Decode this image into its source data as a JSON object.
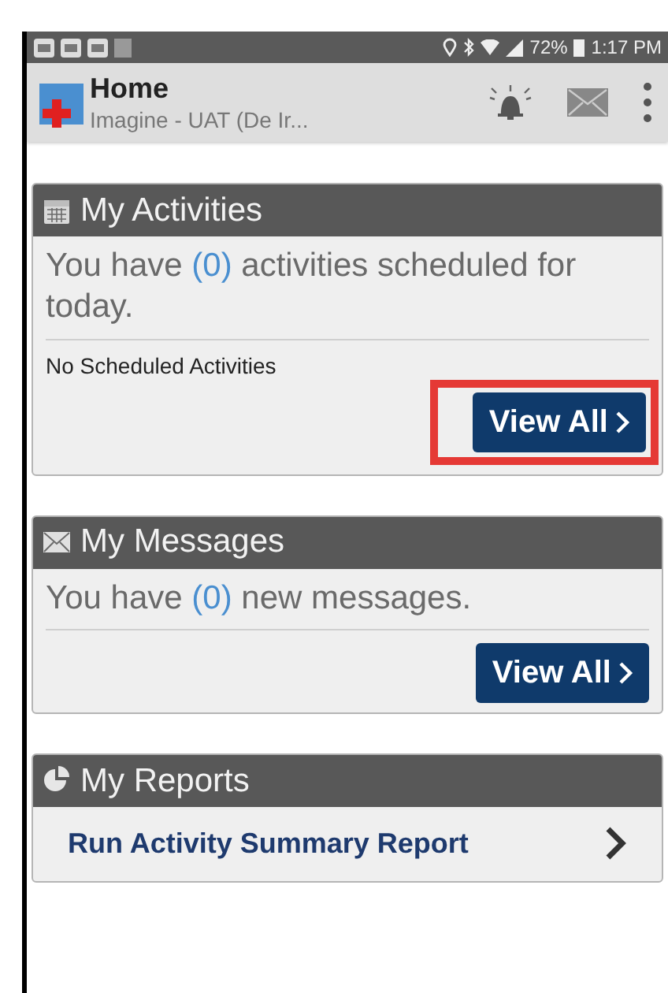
{
  "status_bar": {
    "battery": "72%",
    "time": "1:17 PM"
  },
  "app_bar": {
    "title": "Home",
    "subtitle": "Imagine - UAT (De Ir..."
  },
  "cards": [
    {
      "kind": "activities",
      "title": "My Activities",
      "message": {
        "before": "You have ",
        "count": "(0)",
        "after": " activities scheduled for today."
      },
      "note": "No Scheduled Activities",
      "button": {
        "label": "View All",
        "highlighted": true
      }
    },
    {
      "kind": "messages",
      "title": "My Messages",
      "message": {
        "before": "You have ",
        "count": "(0)",
        "after": " new messages."
      },
      "button": {
        "label": "View All",
        "highlighted": false
      }
    },
    {
      "kind": "reports",
      "title": "My Reports",
      "link": "Run Activity Summary Report"
    }
  ]
}
